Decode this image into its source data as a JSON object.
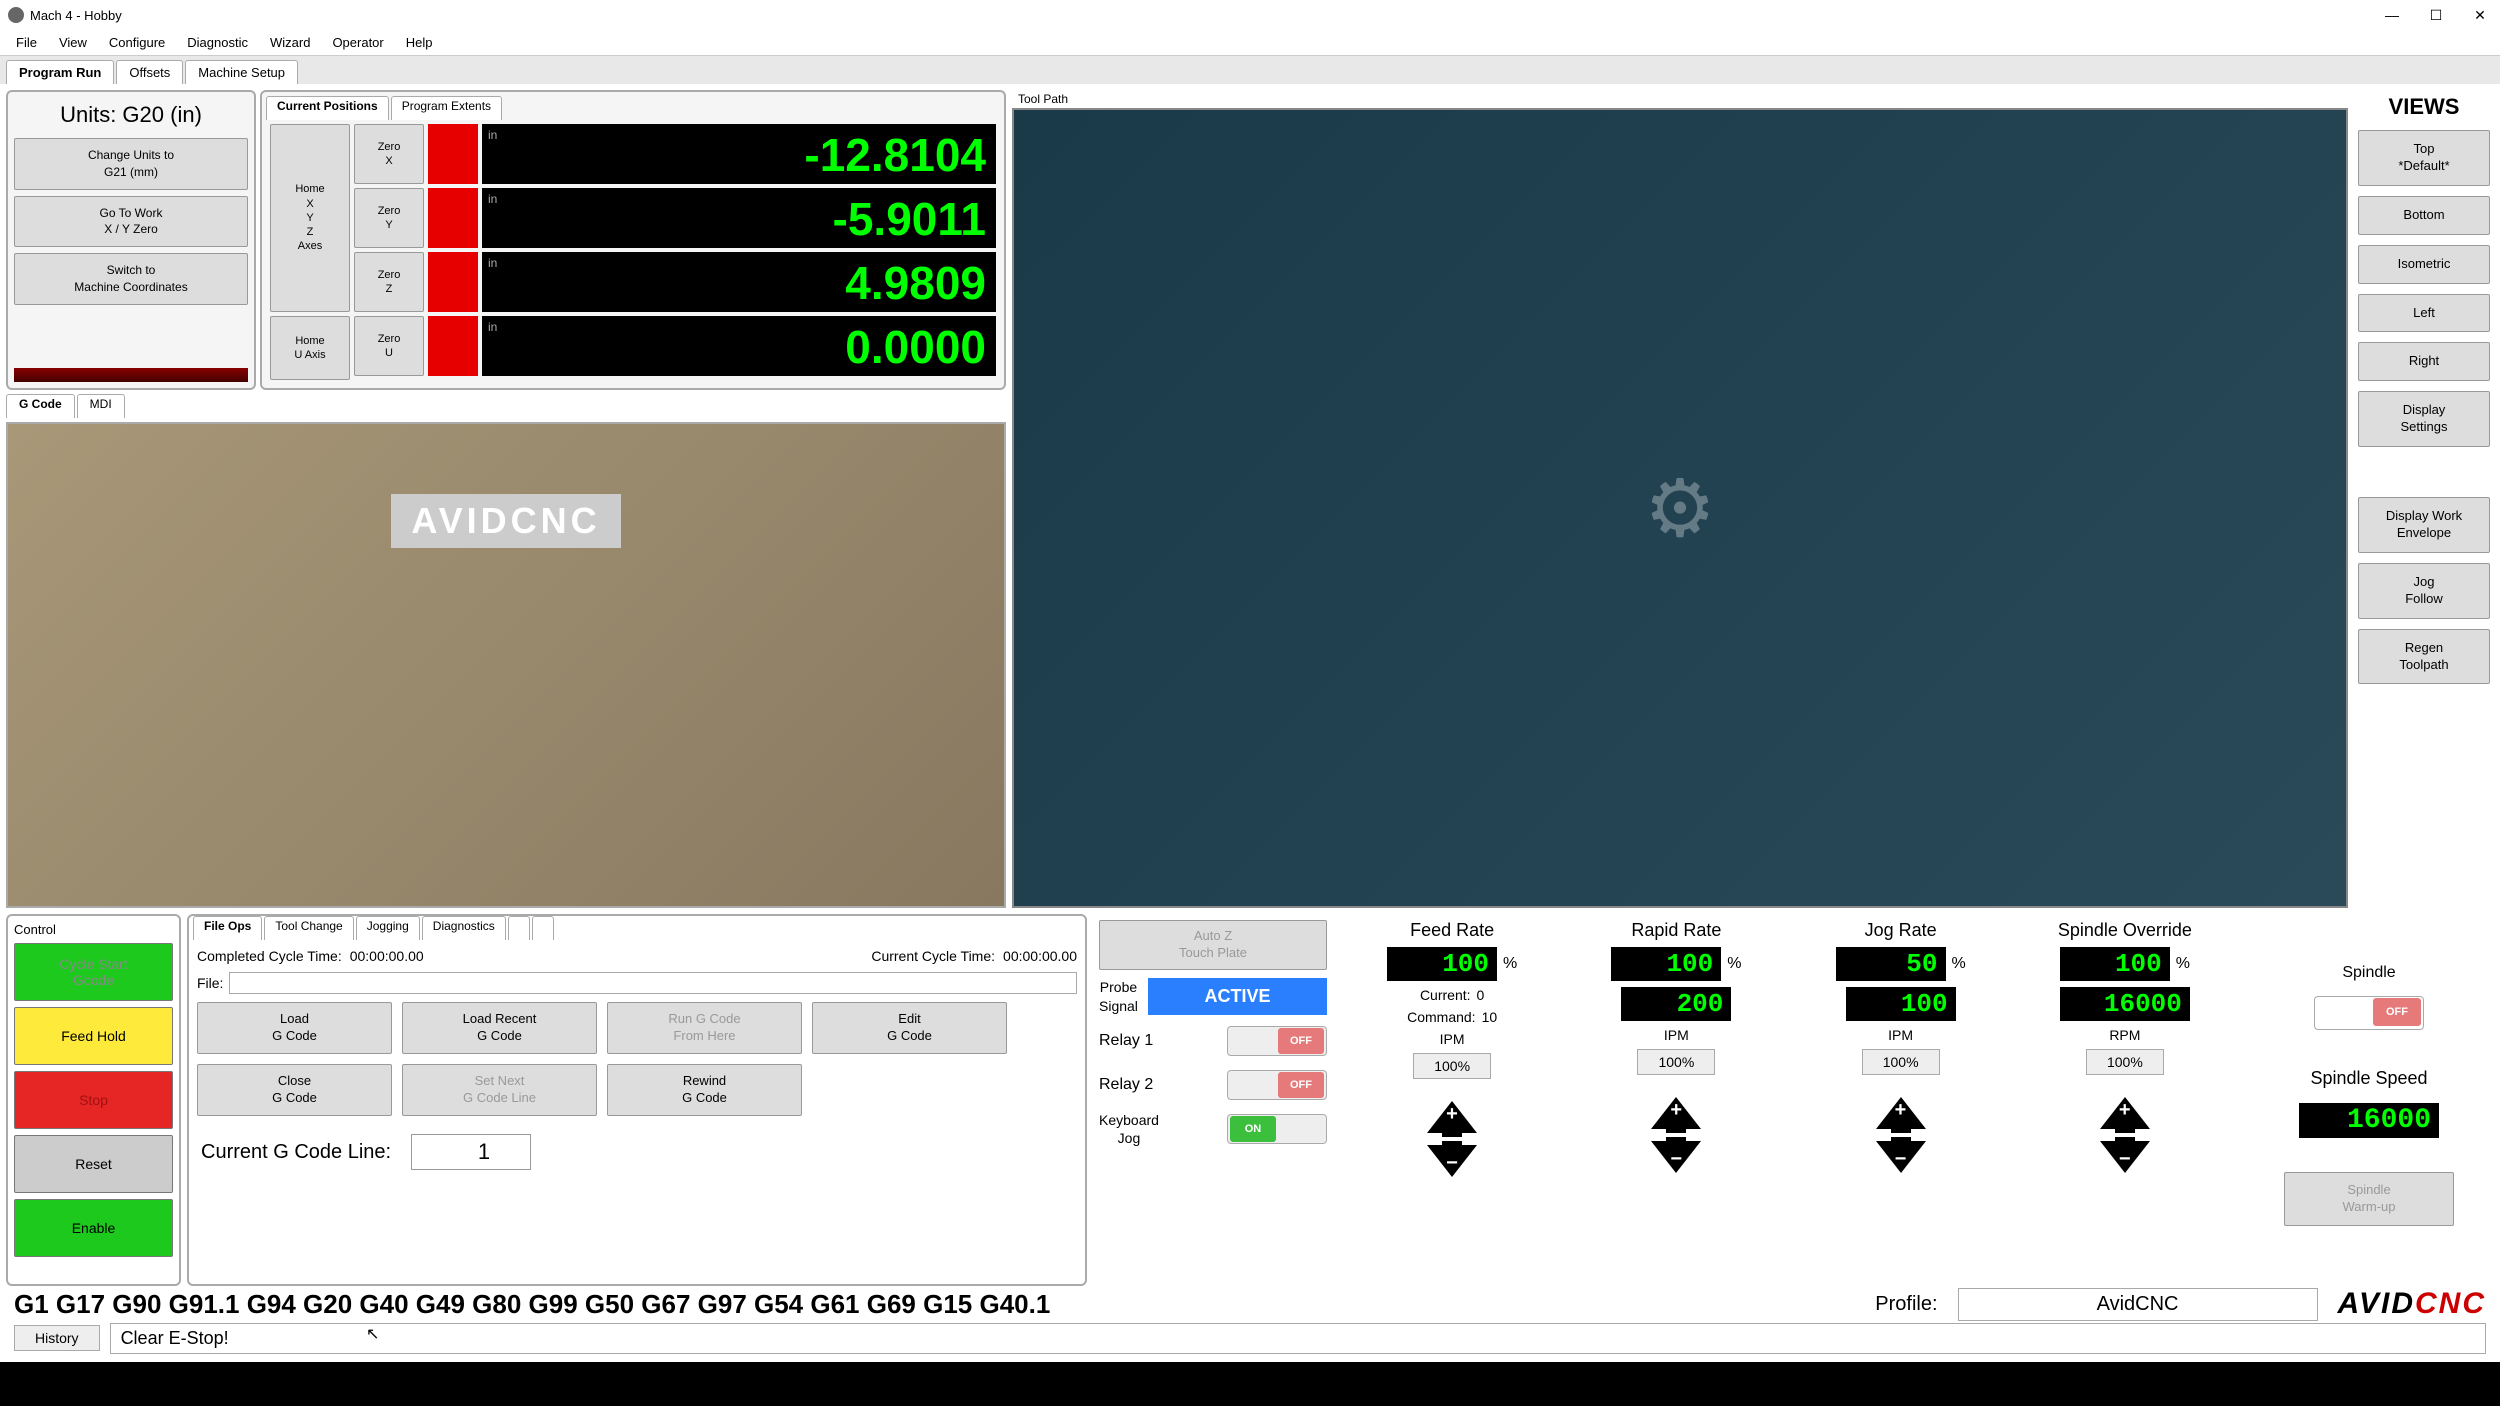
{
  "window": {
    "title": "Mach 4 - Hobby"
  },
  "menubar": [
    "File",
    "View",
    "Configure",
    "Diagnostic",
    "Wizard",
    "Operator",
    "Help"
  ],
  "main_tabs": [
    {
      "label": "Program Run",
      "active": true
    },
    {
      "label": "Offsets",
      "active": false
    },
    {
      "label": "Machine Setup",
      "active": false
    }
  ],
  "units": {
    "title": "Units: G20 (in)",
    "buttons": [
      "Change Units to\nG21 (mm)",
      "Go To Work\nX / Y Zero",
      "Switch to\nMachine Coordinates"
    ]
  },
  "positions": {
    "tabs": [
      {
        "label": "Current Positions",
        "active": true
      },
      {
        "label": "Program Extents",
        "active": false
      }
    ],
    "home_buttons": [
      "Home\nX\nY\nZ\nAxes",
      "Home\nU  Axis"
    ],
    "axes": [
      {
        "zero": "Zero\nX",
        "label": "in",
        "value": "-12.8104"
      },
      {
        "zero": "Zero\nY",
        "label": "in",
        "value": "-5.9011"
      },
      {
        "zero": "Zero\nZ",
        "label": "in",
        "value": "4.9809"
      },
      {
        "zero": "Zero\nU",
        "label": "in",
        "value": "0.0000"
      }
    ]
  },
  "gcode_tabs": [
    {
      "label": "G Code",
      "active": true
    },
    {
      "label": "MDI",
      "active": false
    }
  ],
  "camera_logo": "AVIDCNC",
  "toolpath": {
    "label": "Tool Path"
  },
  "views": {
    "title": "VIEWS",
    "buttons": [
      "Top\n*Default*",
      "Bottom",
      "Isometric",
      "Left",
      "Right",
      "Display\nSettings",
      "Display Work\nEnvelope",
      "Jog\nFollow",
      "Regen\nToolpath"
    ]
  },
  "control": {
    "title": "Control",
    "buttons": [
      {
        "label": "Cycle Start\nGcode",
        "klass": "ctrl-green ctrl-dim"
      },
      {
        "label": "Feed Hold",
        "klass": "ctrl-yellow"
      },
      {
        "label": "Stop",
        "klass": "ctrl-red"
      },
      {
        "label": "Reset",
        "klass": "ctrl-gray"
      },
      {
        "label": "Enable",
        "klass": "ctrl-green"
      }
    ]
  },
  "fileops": {
    "tabs": [
      {
        "label": "File Ops",
        "active": true
      },
      {
        "label": "Tool Change",
        "active": false
      },
      {
        "label": "Jogging",
        "active": false
      },
      {
        "label": "Diagnostics",
        "active": false
      },
      {
        "label": "",
        "active": false
      },
      {
        "label": "",
        "active": false
      }
    ],
    "completed_label": "Completed Cycle Time:",
    "completed_val": "00:00:00.00",
    "current_label": "Current Cycle Time:",
    "current_val": "00:00:00.00",
    "file_label": "File:",
    "file_value": "",
    "buttons": [
      {
        "label": "Load\nG Code",
        "disabled": false
      },
      {
        "label": "Load Recent\nG Code",
        "disabled": false
      },
      {
        "label": "Run G Code\nFrom Here",
        "disabled": true
      },
      {
        "label": "Edit\nG Code",
        "disabled": false
      },
      {
        "label": "Close\nG Code",
        "disabled": false
      },
      {
        "label": "Set Next\nG Code Line",
        "disabled": true
      },
      {
        "label": "Rewind\nG Code",
        "disabled": false
      }
    ],
    "line_label": "Current G Code Line:",
    "line_val": "1"
  },
  "aux": {
    "autoz": "Auto Z\nTouch Plate",
    "probe_label": "Probe\nSignal",
    "probe_status": "ACTIVE",
    "relays": [
      {
        "label": "Relay 1",
        "state": "OFF"
      },
      {
        "label": "Relay 2",
        "state": "OFF"
      }
    ],
    "keyboard_label": "Keyboard\nJog",
    "keyboard_state": "ON"
  },
  "rates": [
    {
      "title": "Feed Rate",
      "dro": "100",
      "info_label": "Current:",
      "info_val": "0",
      "info2_label": "Command:",
      "info2_val": "10",
      "unit": "IPM",
      "percent": "100%",
      "show_info": true,
      "second_dro": ""
    },
    {
      "title": "Rapid Rate",
      "dro": "100",
      "second_dro": "200",
      "unit": "IPM",
      "percent": "100%",
      "show_info": false
    },
    {
      "title": "Jog Rate",
      "dro": "50",
      "second_dro": "100",
      "unit": "IPM",
      "percent": "100%",
      "show_info": false
    },
    {
      "title": "Spindle Override",
      "dro": "100",
      "second_dro": "16000",
      "unit": "RPM",
      "percent": "100%",
      "show_info": false
    }
  ],
  "spindle": {
    "label": "Spindle",
    "state": "OFF",
    "speed_label": "Spindle Speed",
    "speed_val": "16000",
    "warmup": "Spindle\nWarm-up"
  },
  "status": {
    "gcodes": "G1 G17 G90 G91.1 G94 G20 G40 G49 G80 G99 G50 G67 G97 G54 G61 G69 G15 G40.1",
    "profile_label": "Profile:",
    "profile_val": "AvidCNC"
  },
  "history": {
    "button": "History",
    "text": "Clear E-Stop!"
  }
}
